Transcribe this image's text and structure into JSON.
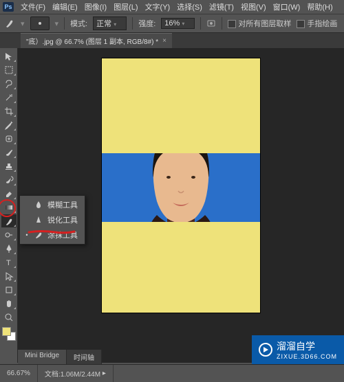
{
  "menu": {
    "items": [
      "文件(F)",
      "编辑(E)",
      "图像(I)",
      "图层(L)",
      "文字(Y)",
      "选择(S)",
      "滤镜(T)",
      "视图(V)",
      "窗口(W)",
      "帮助(H)"
    ]
  },
  "options": {
    "mode_label": "模式:",
    "mode_value": "正常",
    "strength_label": "强度:",
    "strength_value": "16%",
    "sample_all_label": "对所有图层取样",
    "finger_paint_label": "手指绘画"
  },
  "doc_tab": {
    "title": "\"底）.jpg @ 66.7% (图层 1 副本, RGB/8#) *"
  },
  "tools": {
    "names": [
      "move",
      "marquee",
      "lasso",
      "wand",
      "crop",
      "eyedropper",
      "healing",
      "brush",
      "stamp",
      "history-brush",
      "eraser",
      "gradient",
      "blur",
      "dodge",
      "pen",
      "type",
      "path-select",
      "rectangle",
      "hand",
      "zoom"
    ]
  },
  "flyout": {
    "items": [
      {
        "bullet": "",
        "icon": "blur",
        "label": "模糊工具"
      },
      {
        "bullet": "",
        "icon": "sharpen",
        "label": "锐化工具"
      },
      {
        "bullet": "•",
        "icon": "smudge",
        "label": "涂抹工具"
      }
    ]
  },
  "bottom_tabs": {
    "a": "Mini Bridge",
    "b": "时间轴"
  },
  "status": {
    "zoom": "66.67%",
    "doc": "文档:1.06M/2.44M"
  },
  "watermark": {
    "title": "溜溜自学",
    "sub": "ZIXUE.3D66.COM"
  },
  "colors": {
    "accent": "#0a5aa8",
    "canvas_bg": "#eee27a",
    "photo_bg": "#2a6fc9"
  }
}
